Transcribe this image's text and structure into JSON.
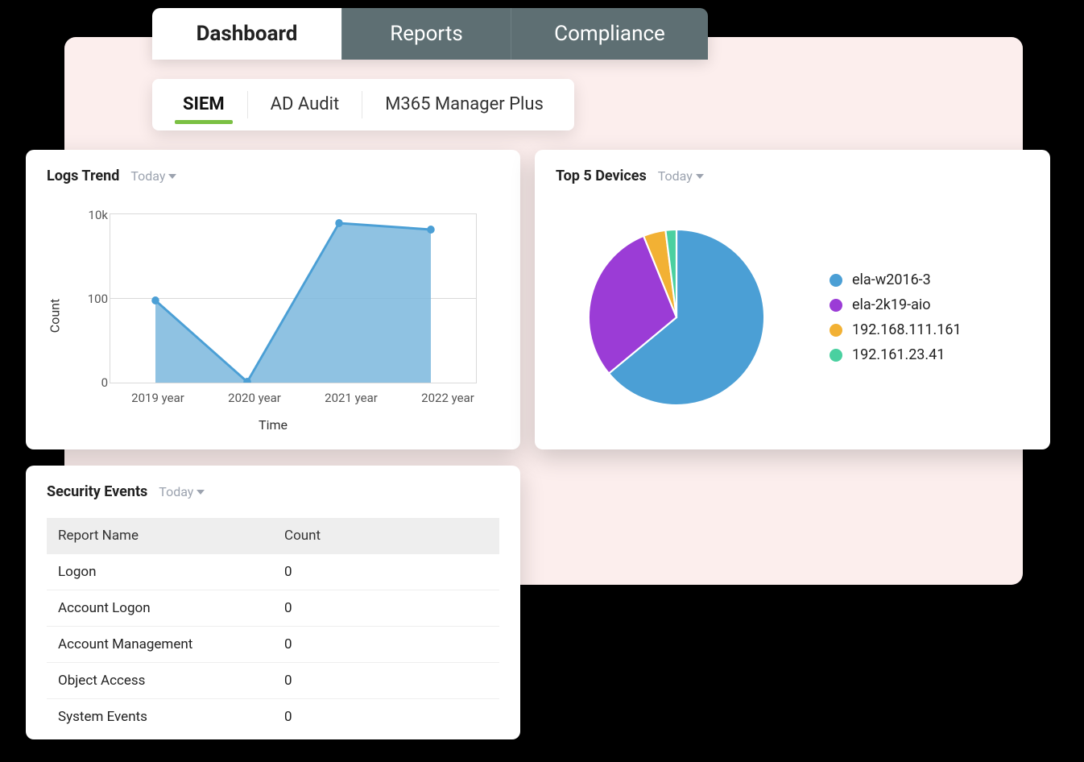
{
  "colors": {
    "blue": "#4b9fd5",
    "blue_fill": "#7bb7dd",
    "purple": "#9b3cd6",
    "orange": "#f2b134",
    "green": "#4ad0a0"
  },
  "tabs": {
    "main": [
      {
        "label": "Dashboard",
        "active": true
      },
      {
        "label": "Reports",
        "active": false
      },
      {
        "label": "Compliance",
        "active": false
      }
    ],
    "sub": [
      {
        "label": "SIEM",
        "active": true
      },
      {
        "label": "AD Audit",
        "active": false
      },
      {
        "label": "M365 Manager Plus",
        "active": false
      }
    ]
  },
  "logs_trend": {
    "title": "Logs Trend",
    "period": "Today",
    "xlabel": "Time",
    "ylabel": "Count",
    "y_ticks": [
      "0",
      "100",
      "10k"
    ]
  },
  "top_devices": {
    "title": "Top 5 Devices",
    "period": "Today",
    "items": [
      {
        "label": "ela-w2016-3",
        "color_key": "blue"
      },
      {
        "label": "ela-2k19-aio",
        "color_key": "purple"
      },
      {
        "label": "192.168.111.161",
        "color_key": "orange"
      },
      {
        "label": "192.161.23.41",
        "color_key": "green"
      }
    ]
  },
  "security_events": {
    "title": "Security Events",
    "period": "Today",
    "columns": [
      "Report Name",
      "Count"
    ],
    "rows": [
      {
        "name": "Logon",
        "count": "0"
      },
      {
        "name": "Account Logon",
        "count": "0"
      },
      {
        "name": "Account Management",
        "count": "0"
      },
      {
        "name": "Object Access",
        "count": "0"
      },
      {
        "name": "System Events",
        "count": "0"
      }
    ]
  },
  "chart_data": [
    {
      "type": "area",
      "title": "Logs Trend",
      "xlabel": "Time",
      "ylabel": "Count",
      "yscale": "log",
      "y_ticks": [
        0,
        100,
        10000
      ],
      "categories": [
        "2019 year",
        "2020 year",
        "2021 year",
        "2022 year"
      ],
      "values": [
        90,
        1,
        6000,
        5000
      ]
    },
    {
      "type": "pie",
      "title": "Top 5 Devices",
      "series": [
        {
          "name": "ela-w2016-3",
          "value": 64
        },
        {
          "name": "ela-2k19-aio",
          "value": 30
        },
        {
          "name": "192.168.111.161",
          "value": 4
        },
        {
          "name": "192.161.23.41",
          "value": 2
        }
      ]
    },
    {
      "type": "table",
      "title": "Security Events",
      "columns": [
        "Report Name",
        "Count"
      ],
      "rows": [
        [
          "Logon",
          0
        ],
        [
          "Account Logon",
          0
        ],
        [
          "Account Management",
          0
        ],
        [
          "Object Access",
          0
        ],
        [
          "System Events",
          0
        ]
      ]
    }
  ]
}
